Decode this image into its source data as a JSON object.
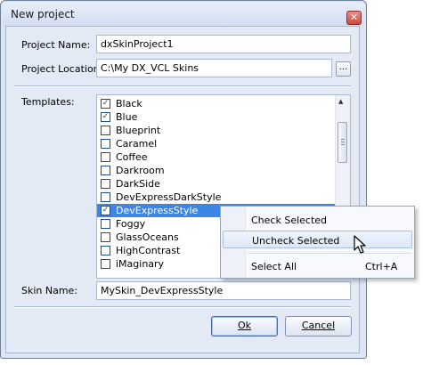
{
  "window": {
    "title": "New project",
    "close_glyph": "✕"
  },
  "form": {
    "project_name_label": "Project Name:",
    "project_name_value": "dxSkinProject1",
    "project_location_label": "Project Location:",
    "project_location_value": "C:\\My DX_VCL Skins",
    "browse_label": "...",
    "templates_label": "Templates:",
    "skin_name_label": "Skin Name:",
    "skin_name_value": "MySkin_DevExpressStyle"
  },
  "templates": [
    {
      "label": "Black",
      "checked": true
    },
    {
      "label": "Blue",
      "checked": true
    },
    {
      "label": "Blueprint",
      "checked": false
    },
    {
      "label": "Caramel",
      "checked": false
    },
    {
      "label": "Coffee",
      "checked": false
    },
    {
      "label": "Darkroom",
      "checked": false
    },
    {
      "label": "DarkSide",
      "checked": false
    },
    {
      "label": "DevExpressDarkStyle",
      "checked": false
    },
    {
      "label": "DevExpressStyle",
      "checked": true,
      "selected": true
    },
    {
      "label": "Foggy",
      "checked": false
    },
    {
      "label": "GlassOceans",
      "checked": false
    },
    {
      "label": "HighContrast",
      "checked": false
    },
    {
      "label": "iMaginary",
      "checked": false
    }
  ],
  "buttons": {
    "ok_label": "Ok",
    "cancel_label": "Cancel"
  },
  "context_menu": {
    "check_selected": "Check Selected",
    "uncheck_selected": "Uncheck Selected",
    "select_all": "Select All",
    "select_all_shortcut": "Ctrl+A"
  },
  "colors": {
    "selection": "#3d86e6",
    "dialog_background": "#e3eaf5"
  },
  "icons": {
    "check": "✓",
    "scroll_up": "▲",
    "scroll_down": "▼"
  }
}
